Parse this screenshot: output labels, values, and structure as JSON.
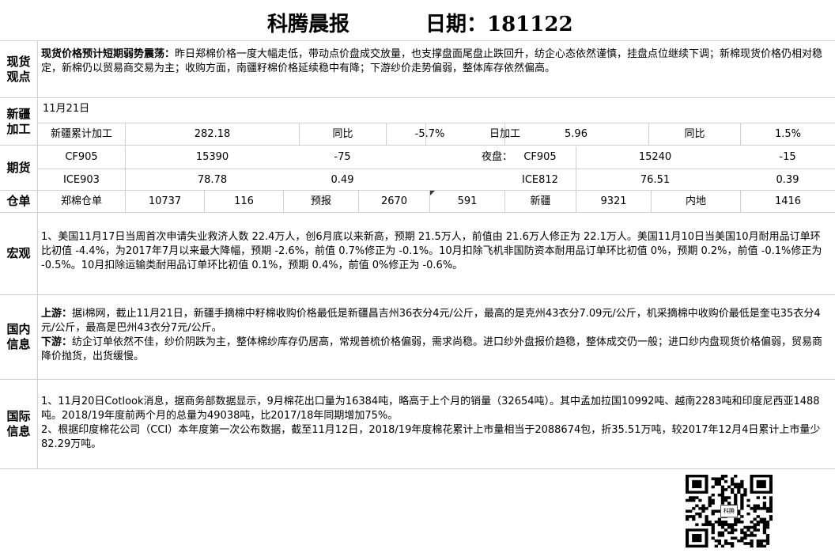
{
  "header": {
    "title": "科腾晨报",
    "date_label": "日期：181122"
  },
  "spot": {
    "label": "现货观点",
    "headline": "现货价格预计短期弱势震荡：",
    "text": "昨日郑棉价格一度大幅走低，带动点价盘成交放量，也支撑盘面尾盘止跌回升，纺企心态依然谨慎，挂盘点位继续下调；新棉现货价格仍相对稳定，新棉仍以贸易商交易为主；收购方面，南疆籽棉价格延续稳中有降；下游纱价走势偏弱，整体库存依然偏高。"
  },
  "xinjiang": {
    "label": "新疆加工",
    "date": "11月21日",
    "cum_label": "新疆累计加工",
    "cum_value": "282.18",
    "yoy1_label": "同比",
    "yoy1_value": "-5.7%",
    "daily_label": "日加工",
    "daily_value": "5.96",
    "yoy2_label": "同比",
    "yoy2_value": "1.5%"
  },
  "futures": {
    "label": "期货",
    "night_label": "夜盘：",
    "rows": [
      {
        "c1": "CF905",
        "c2": "15390",
        "c3": "-75",
        "c4": "CF905",
        "c5": "15240",
        "c6": "-15"
      },
      {
        "c1": "ICE903",
        "c2": "78.78",
        "c3": "0.49",
        "c4": "ICE812",
        "c5": "76.51",
        "c6": "0.39"
      }
    ]
  },
  "warehouse": {
    "label": "仓单",
    "zz_label": "郑棉仓单",
    "zz_value": "10737",
    "zz_change": "116",
    "forecast_label": "预报",
    "forecast_value": "2670",
    "forecast_change": "591",
    "xj_label": "新疆",
    "xj_value": "9321",
    "nd_label": "内地",
    "nd_value": "1416"
  },
  "macro": {
    "label": "宏观",
    "text": "1、美国11月17日当周首次申请失业救济人数 22.4万人，创6月底以来新高，预期 21.5万人，前值由 21.6万人修正为 22.1万人。美国11月10日当美国10月耐用品订单环比初值 -4.4%，为2017年7月以来最大降幅，预期 -2.6%，前值 0.7%修正为 -0.1%。10月扣除飞机非国防资本耐用品订单环比初值 0%，预期 0.2%，前值 -0.1%修正为 -0.5%。10月扣除运输类耐用品订单环比初值 0.1%，预期 0.4%，前值 0%修正为 -0.6%。"
  },
  "domestic": {
    "label": "国内信息",
    "up_label": "上游：",
    "up_text": "据i棉网，截止11月21日，新疆手摘棉中籽棉收购价格最低是新疆昌吉州36衣分4元/公斤，最高的是克州43衣分7.09元/公斤，机采摘棉中收购价最低是奎屯35衣分4元/公斤，最高是巴州43衣分7元/公斤。",
    "down_label": "下游：",
    "down_text": "纺企订单依然不佳，纱价阴跌为主，整体棉纱库存仍居高，常规普梳价格偏弱，需求尚稳。进口纱外盘报价趋稳，整体成交仍一般；进口纱内盘现货价格偏弱，贸易商降价抛货，出货缓慢。"
  },
  "international": {
    "label": "国际信息",
    "line1": "1、11月20日Cotlook消息，据商务部数据显示，9月棉花出口量为16384吨，略高于上个月的销量（32654吨）。其中孟加拉国10992吨、越南2283吨和印度尼西亚1488吨。2018/19年度前两个月的总量为49038吨，比2017/18年同期增加75%。",
    "line2": "2、根据印度棉花公司（CCI）本年度第一次公布数据，截至11月12日，2018/19年度棉花累计上市量相当于2088674包，折35.51万吨，较2017年12月4日累计上市量少82.29万吨。"
  },
  "qr": {
    "center_text": "科腾"
  }
}
